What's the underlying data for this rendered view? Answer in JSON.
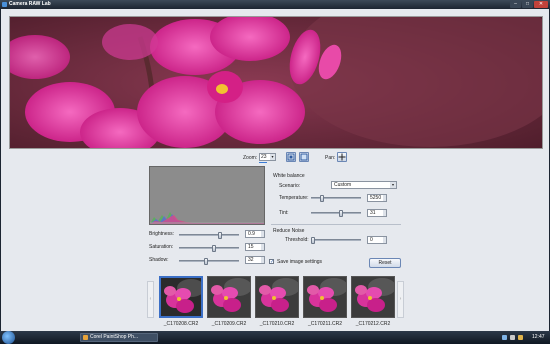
{
  "window": {
    "title": "Camera RAW Lab",
    "min_glyph": "–",
    "max_glyph": "□",
    "close_glyph": "✕"
  },
  "toolbar": {
    "zoom_label": "Zoom:",
    "zoom_value": "23",
    "pan_label": "Pan:",
    "fit_icon": "fit-to-window-icon",
    "actual_icon": "actual-size-icon",
    "pan_icon": "pan-cross-icon"
  },
  "adjustments": {
    "brightness": {
      "label": "Brightness:",
      "value": "0.9",
      "level": 0.7
    },
    "saturation": {
      "label": "Saturation:",
      "value": "15",
      "level": 0.6
    },
    "shadow": {
      "label": "Shadow:",
      "value": "32",
      "level": 0.45
    }
  },
  "white_balance": {
    "title": "White balance",
    "scenario_label": "Scenario:",
    "scenario_value": "Custom",
    "temperature_label": "Temperature:",
    "temperature_value": "5250",
    "temperature_level": 0.2,
    "tint_label": "Tint:",
    "tint_value": "31",
    "tint_level": 0.62
  },
  "reduce_noise": {
    "title": "Reduce Noise",
    "threshold_label": "Threshold:",
    "threshold_value": "0",
    "threshold_level": 0.0
  },
  "save_settings": {
    "label": "Save image settings",
    "checked": true,
    "check_glyph": "✓"
  },
  "reset_label": "Reset",
  "filmstrip": {
    "prev_glyph": "‹",
    "next_glyph": "›",
    "items": [
      {
        "name": "_C170208.CR2",
        "selected": true
      },
      {
        "name": "_C170209.CR2",
        "selected": false
      },
      {
        "name": "_C170210.CR2",
        "selected": false
      },
      {
        "name": "_C170211.CR2",
        "selected": false
      },
      {
        "name": "_C170212.CR2",
        "selected": false
      }
    ]
  },
  "taskbar": {
    "task_label": "Corel PaintShop Ph...",
    "clock": "12:47"
  },
  "colors": {
    "accent": "#3b6fc6",
    "flower": "#e0309a",
    "background_wine": "#6e2a3c"
  }
}
